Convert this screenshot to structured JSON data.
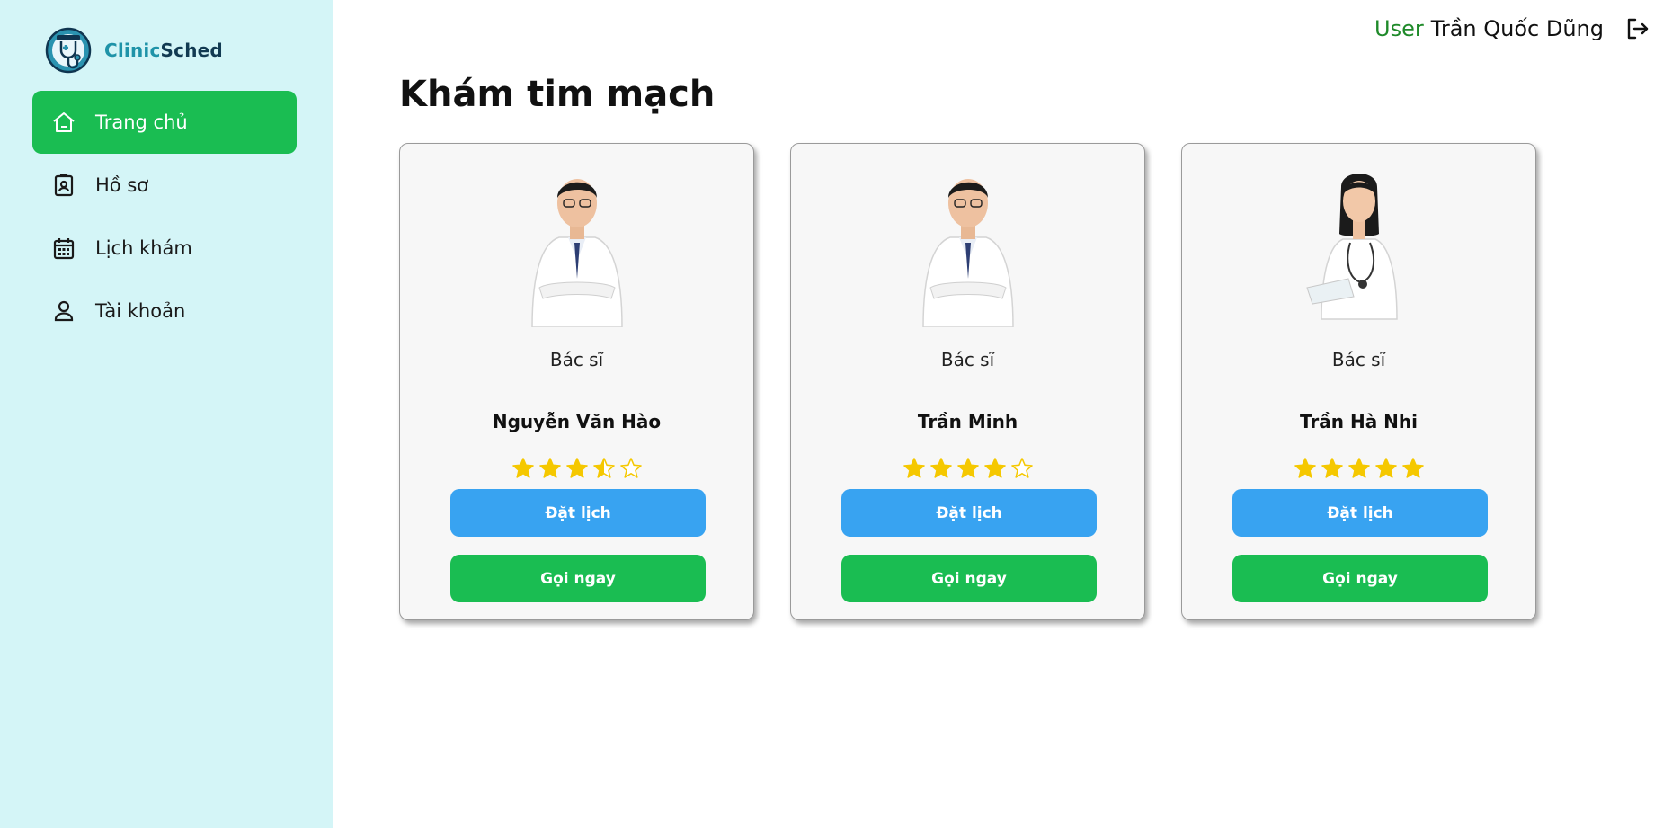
{
  "app": {
    "brand_part1": "Clinic",
    "brand_part2": "Sched"
  },
  "colors": {
    "sidebar_bg": "#d4f5f7",
    "active": "#1abd52",
    "book": "#38a3f1",
    "star": "#f5c800",
    "user_prefix": "#1f8a2a"
  },
  "sidebar": {
    "items": [
      {
        "label": "Trang chủ",
        "icon": "home-icon",
        "active": true
      },
      {
        "label": "Hồ sơ",
        "icon": "profile-badge-icon",
        "active": false
      },
      {
        "label": "Lịch khám",
        "icon": "calendar-icon",
        "active": false
      },
      {
        "label": "Tài khoản",
        "icon": "user-icon",
        "active": false
      }
    ]
  },
  "header": {
    "user_prefix": "User",
    "user_name": "Trần Quốc Dũng",
    "logout_icon": "logout-icon"
  },
  "main": {
    "title": "Khám tim mạch",
    "doctors": [
      {
        "role": "Bác sĩ",
        "name": "Nguyễn Văn Hào",
        "rating": 3.5,
        "gender": "male",
        "book_label": "Đặt lịch",
        "call_label": "Gọi ngay"
      },
      {
        "role": "Bác sĩ",
        "name": "Trần Minh",
        "rating": 4,
        "gender": "male",
        "book_label": "Đặt lịch",
        "call_label": "Gọi ngay"
      },
      {
        "role": "Bác sĩ",
        "name": "Trần Hà Nhi",
        "rating": 5,
        "gender": "female",
        "book_label": "Đặt lịch",
        "call_label": "Gọi ngay"
      }
    ]
  }
}
